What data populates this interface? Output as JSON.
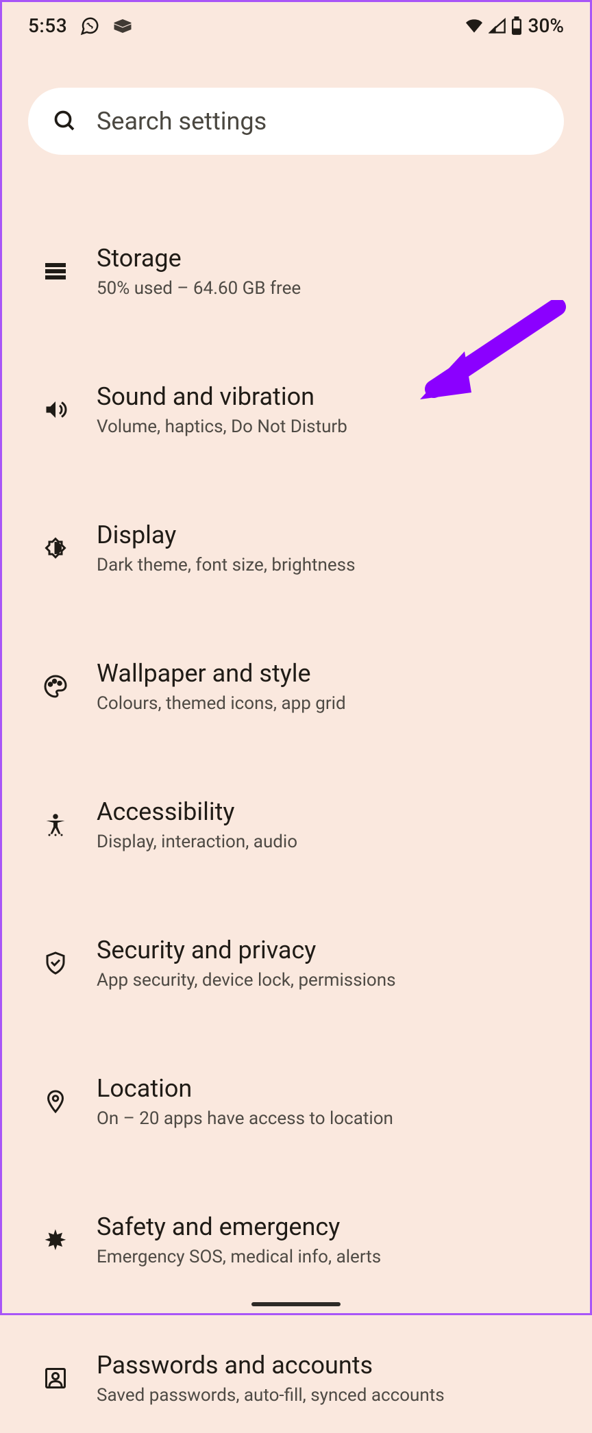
{
  "status_bar": {
    "time": "5:53",
    "battery_percent": "30%"
  },
  "search": {
    "placeholder": "Search settings"
  },
  "settings": [
    {
      "icon": "storage",
      "title": "Storage",
      "subtitle": "50% used – 64.60 GB free"
    },
    {
      "icon": "sound",
      "title": "Sound and vibration",
      "subtitle": "Volume, haptics, Do Not Disturb",
      "highlighted": true
    },
    {
      "icon": "display",
      "title": "Display",
      "subtitle": "Dark theme, font size, brightness"
    },
    {
      "icon": "wallpaper",
      "title": "Wallpaper and style",
      "subtitle": "Colours, themed icons, app grid"
    },
    {
      "icon": "accessibility",
      "title": "Accessibility",
      "subtitle": "Display, interaction, audio"
    },
    {
      "icon": "security",
      "title": "Security and privacy",
      "subtitle": "App security, device lock, permissions"
    },
    {
      "icon": "location",
      "title": "Location",
      "subtitle": "On – 20 apps have access to location"
    },
    {
      "icon": "safety",
      "title": "Safety and emergency",
      "subtitle": "Emergency SOS, medical info, alerts"
    },
    {
      "icon": "passwords",
      "title": "Passwords and accounts",
      "subtitle": "Saved passwords, auto-fill, synced accounts"
    }
  ],
  "annotation": {
    "arrow_color": "#8b00ff"
  }
}
